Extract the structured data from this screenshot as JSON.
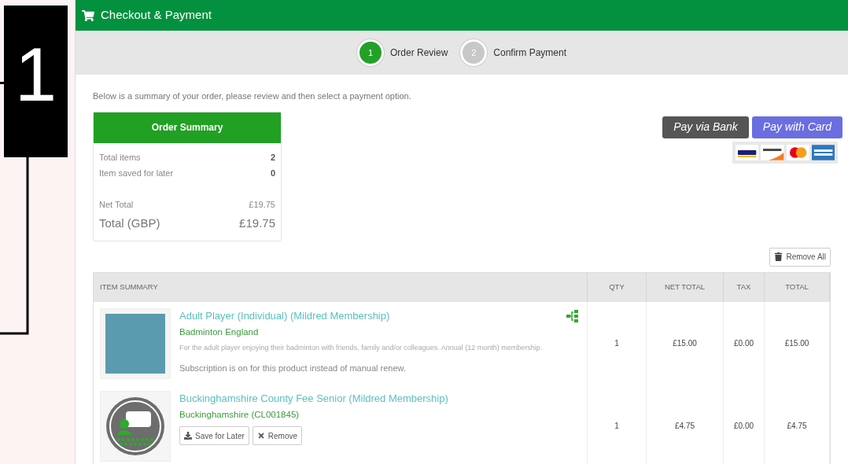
{
  "callout": {
    "label": "1"
  },
  "header": {
    "title": "Checkout & Payment"
  },
  "steps": [
    {
      "number": "1",
      "label": "Order Review",
      "active": true
    },
    {
      "number": "2",
      "label": "Confirm Payment",
      "active": false
    }
  ],
  "intro": "Below is a summary of your order, please review and then select a payment option.",
  "summary": {
    "title": "Order Summary",
    "rows": [
      {
        "label": "Total items",
        "value": "2"
      },
      {
        "label": "Item saved for later",
        "value": "0"
      }
    ],
    "net_label": "Net Total",
    "net_value": "£19.75",
    "total_label": "Total (GBP)",
    "total_value": "£19.75"
  },
  "payment_buttons": [
    {
      "label": "Pay via Bank",
      "kind": "bank"
    },
    {
      "label": "Pay with Card",
      "kind": "card"
    }
  ],
  "remove_all": "Remove All",
  "table": {
    "columns": [
      "ITEM SUMMARY",
      "QTY",
      "NET TOTAL",
      "TAX",
      "TOTAL"
    ],
    "rows": [
      {
        "kind": "photo",
        "title": "Adult Player (Individual) (Mildred Membership)",
        "org": "Badminton England",
        "description": "For the adult player enjoying their badminton with friends, family and/or colleagues. Annual (12 month) membership.",
        "note": "Subscription is on for this product instead of manual renew.",
        "qty": "1",
        "net": "£15.00",
        "tax": "£0.00",
        "total": "£15.00"
      },
      {
        "kind": "emblem",
        "title": "Buckinghamshire County Fee Senior (Mildred Membership)",
        "org": "Buckinghamshire (CL001845)",
        "actions": [
          "Save for Later",
          "Remove"
        ],
        "qty": "1",
        "net": "£4.75",
        "tax": "£0.00",
        "total": "£4.75"
      }
    ]
  }
}
